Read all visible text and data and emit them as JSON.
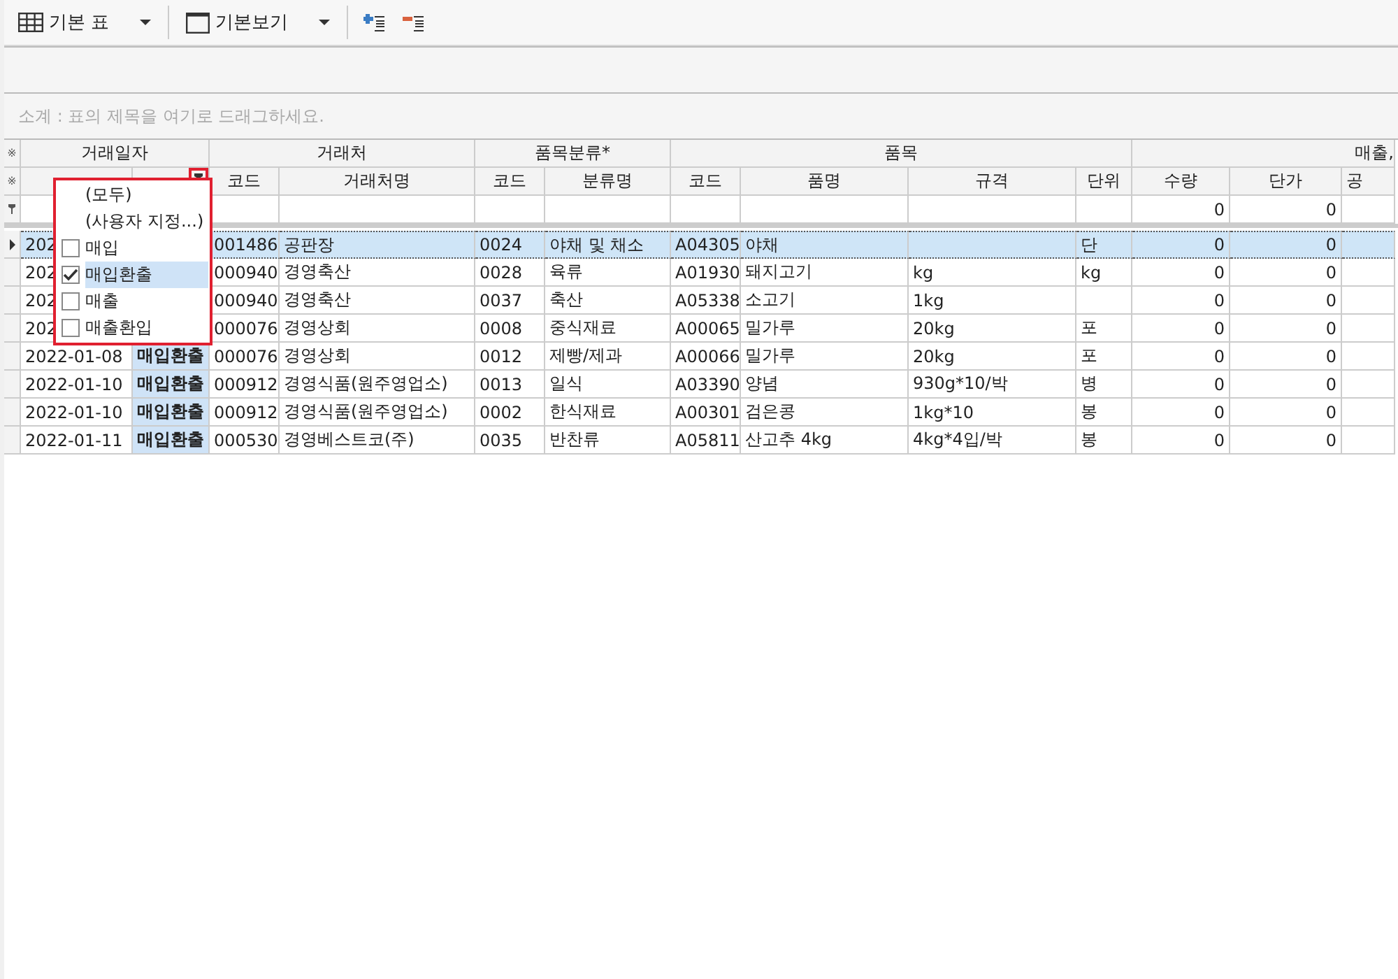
{
  "toolbar": [
    {
      "kind": "table",
      "label": "기본 표"
    },
    {
      "kind": "window",
      "label": "기본보기"
    },
    {
      "kind": "add"
    },
    {
      "kind": "remove"
    }
  ],
  "group_panel": {
    "placeholder": "소계 : 표의 제목을 여기로 드래그하세요."
  },
  "grid": {
    "header_marks": [
      "※",
      "※"
    ],
    "groups": [
      {
        "label": "거래일자"
      },
      {
        "label": "거래처"
      },
      {
        "label": "품목분류*"
      },
      {
        "label": "품목"
      },
      {
        "label": "매출,"
      }
    ],
    "columns": [
      {
        "filtered": false
      },
      {
        "filtered": true
      },
      {
        "label": "코드",
        "filtered": false
      },
      {
        "label": "거래처명",
        "filtered": false
      },
      {
        "label": "코드",
        "filtered": false
      },
      {
        "label": "분류명",
        "filtered": false
      },
      {
        "label": "코드",
        "filtered": false
      },
      {
        "label": "품명",
        "filtered": false
      },
      {
        "label": "규격",
        "filtered": false
      },
      {
        "label": "단위",
        "filtered": false
      },
      {
        "label": "수량",
        "filtered": false
      },
      {
        "label": "단가",
        "filtered": false
      },
      {
        "label": "공",
        "filtered": false
      }
    ],
    "filter_row": {
      "qty": "0",
      "price": "0"
    },
    "rows": [
      {
        "selected": true,
        "date": "202",
        "cust_code": "001486",
        "cust_name": "공판장",
        "cat_code": "0024",
        "cat_name": "야채 및 채소",
        "item_code": "A04305",
        "item_name": "야채",
        "unit": "단",
        "qty": "0",
        "price": "0"
      },
      {
        "selected": false,
        "date": "202",
        "cust_code": "000940",
        "cust_name": "경영축산",
        "cat_code": "0028",
        "cat_name": "육류",
        "item_code": "A01930",
        "item_name": "돼지고기",
        "spec": "kg",
        "unit": "kg",
        "qty": "0",
        "price": "0"
      },
      {
        "selected": false,
        "date": "202",
        "cust_code": "000940",
        "cust_name": "경영축산",
        "cat_code": "0037",
        "cat_name": "축산",
        "item_code": "A05338",
        "item_name": "소고기",
        "spec": "1kg",
        "qty": "0",
        "price": "0"
      },
      {
        "selected": false,
        "date": "202",
        "cust_code": "000076",
        "cust_name": "경영상회",
        "cat_code": "0008",
        "cat_name": "중식재료",
        "item_code": "A00065",
        "item_name": "밀가루",
        "spec": "20kg",
        "unit": "포",
        "qty": "0",
        "price": "0"
      },
      {
        "selected": false,
        "date": "2022-01-08",
        "type": "매입환출",
        "cust_code": "000076",
        "cust_name": "경영상회",
        "cat_code": "0012",
        "cat_name": "제빵/제과",
        "item_code": "A00066",
        "item_name": "밀가루",
        "spec": "20kg",
        "unit": "포",
        "qty": "0",
        "price": "0"
      },
      {
        "selected": false,
        "date": "2022-01-10",
        "type": "매입환출",
        "cust_code": "000912",
        "cust_name": "경영식품(원주영업소)",
        "cat_code": "0013",
        "cat_name": "일식",
        "item_code": "A03390",
        "item_name": "양념",
        "spec": "930g*10/박",
        "unit": "병",
        "qty": "0",
        "price": "0"
      },
      {
        "selected": false,
        "date": "2022-01-10",
        "type": "매입환출",
        "cust_code": "000912",
        "cust_name": "경영식품(원주영업소)",
        "cat_code": "0002",
        "cat_name": "한식재료",
        "item_code": "A00301",
        "item_name": "검은콩",
        "spec": "1kg*10",
        "unit": "봉",
        "qty": "0",
        "price": "0"
      },
      {
        "selected": false,
        "date": "2022-01-11",
        "type": "매입환출",
        "cust_code": "000530",
        "cust_name": "경영베스트코(주)",
        "cat_code": "0035",
        "cat_name": "반찬류",
        "item_code": "A05811",
        "item_name": "산고추 4kg",
        "spec": "4kg*4입/박",
        "unit": "봉",
        "qty": "0",
        "price": "0"
      }
    ]
  },
  "filter_menu": {
    "items": [
      {
        "kind": "text",
        "label": "(모두)",
        "selected": false
      },
      {
        "kind": "text",
        "label": "(사용자 지정...)",
        "selected": false
      },
      {
        "kind": "checkbox",
        "label": "매입",
        "checked": false,
        "selected": false
      },
      {
        "kind": "checkbox",
        "label": "매입환출",
        "checked": true,
        "selected": true
      },
      {
        "kind": "checkbox",
        "label": "매출",
        "checked": false,
        "selected": false
      },
      {
        "kind": "checkbox",
        "label": "매출환입",
        "checked": false,
        "selected": false
      }
    ]
  }
}
